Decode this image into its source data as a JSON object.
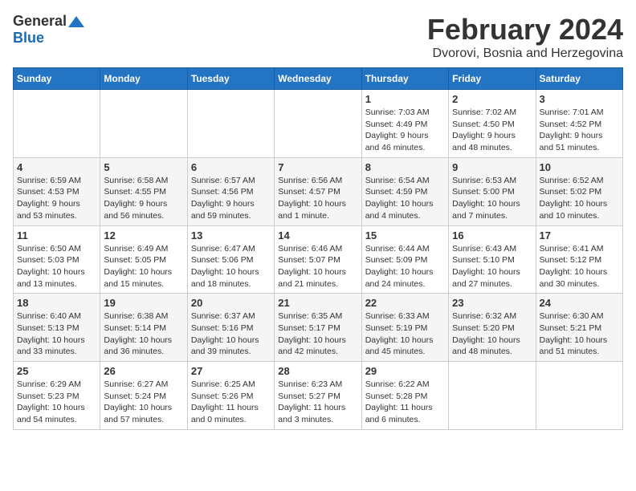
{
  "logo": {
    "general": "General",
    "blue": "Blue"
  },
  "header": {
    "month": "February 2024",
    "location": "Dvorovi, Bosnia and Herzegovina"
  },
  "weekdays": [
    "Sunday",
    "Monday",
    "Tuesday",
    "Wednesday",
    "Thursday",
    "Friday",
    "Saturday"
  ],
  "weeks": [
    [
      {
        "day": "",
        "info": ""
      },
      {
        "day": "",
        "info": ""
      },
      {
        "day": "",
        "info": ""
      },
      {
        "day": "",
        "info": ""
      },
      {
        "day": "1",
        "info": "Sunrise: 7:03 AM\nSunset: 4:49 PM\nDaylight: 9 hours\nand 46 minutes."
      },
      {
        "day": "2",
        "info": "Sunrise: 7:02 AM\nSunset: 4:50 PM\nDaylight: 9 hours\nand 48 minutes."
      },
      {
        "day": "3",
        "info": "Sunrise: 7:01 AM\nSunset: 4:52 PM\nDaylight: 9 hours\nand 51 minutes."
      }
    ],
    [
      {
        "day": "4",
        "info": "Sunrise: 6:59 AM\nSunset: 4:53 PM\nDaylight: 9 hours\nand 53 minutes."
      },
      {
        "day": "5",
        "info": "Sunrise: 6:58 AM\nSunset: 4:55 PM\nDaylight: 9 hours\nand 56 minutes."
      },
      {
        "day": "6",
        "info": "Sunrise: 6:57 AM\nSunset: 4:56 PM\nDaylight: 9 hours\nand 59 minutes."
      },
      {
        "day": "7",
        "info": "Sunrise: 6:56 AM\nSunset: 4:57 PM\nDaylight: 10 hours\nand 1 minute."
      },
      {
        "day": "8",
        "info": "Sunrise: 6:54 AM\nSunset: 4:59 PM\nDaylight: 10 hours\nand 4 minutes."
      },
      {
        "day": "9",
        "info": "Sunrise: 6:53 AM\nSunset: 5:00 PM\nDaylight: 10 hours\nand 7 minutes."
      },
      {
        "day": "10",
        "info": "Sunrise: 6:52 AM\nSunset: 5:02 PM\nDaylight: 10 hours\nand 10 minutes."
      }
    ],
    [
      {
        "day": "11",
        "info": "Sunrise: 6:50 AM\nSunset: 5:03 PM\nDaylight: 10 hours\nand 13 minutes."
      },
      {
        "day": "12",
        "info": "Sunrise: 6:49 AM\nSunset: 5:05 PM\nDaylight: 10 hours\nand 15 minutes."
      },
      {
        "day": "13",
        "info": "Sunrise: 6:47 AM\nSunset: 5:06 PM\nDaylight: 10 hours\nand 18 minutes."
      },
      {
        "day": "14",
        "info": "Sunrise: 6:46 AM\nSunset: 5:07 PM\nDaylight: 10 hours\nand 21 minutes."
      },
      {
        "day": "15",
        "info": "Sunrise: 6:44 AM\nSunset: 5:09 PM\nDaylight: 10 hours\nand 24 minutes."
      },
      {
        "day": "16",
        "info": "Sunrise: 6:43 AM\nSunset: 5:10 PM\nDaylight: 10 hours\nand 27 minutes."
      },
      {
        "day": "17",
        "info": "Sunrise: 6:41 AM\nSunset: 5:12 PM\nDaylight: 10 hours\nand 30 minutes."
      }
    ],
    [
      {
        "day": "18",
        "info": "Sunrise: 6:40 AM\nSunset: 5:13 PM\nDaylight: 10 hours\nand 33 minutes."
      },
      {
        "day": "19",
        "info": "Sunrise: 6:38 AM\nSunset: 5:14 PM\nDaylight: 10 hours\nand 36 minutes."
      },
      {
        "day": "20",
        "info": "Sunrise: 6:37 AM\nSunset: 5:16 PM\nDaylight: 10 hours\nand 39 minutes."
      },
      {
        "day": "21",
        "info": "Sunrise: 6:35 AM\nSunset: 5:17 PM\nDaylight: 10 hours\nand 42 minutes."
      },
      {
        "day": "22",
        "info": "Sunrise: 6:33 AM\nSunset: 5:19 PM\nDaylight: 10 hours\nand 45 minutes."
      },
      {
        "day": "23",
        "info": "Sunrise: 6:32 AM\nSunset: 5:20 PM\nDaylight: 10 hours\nand 48 minutes."
      },
      {
        "day": "24",
        "info": "Sunrise: 6:30 AM\nSunset: 5:21 PM\nDaylight: 10 hours\nand 51 minutes."
      }
    ],
    [
      {
        "day": "25",
        "info": "Sunrise: 6:29 AM\nSunset: 5:23 PM\nDaylight: 10 hours\nand 54 minutes."
      },
      {
        "day": "26",
        "info": "Sunrise: 6:27 AM\nSunset: 5:24 PM\nDaylight: 10 hours\nand 57 minutes."
      },
      {
        "day": "27",
        "info": "Sunrise: 6:25 AM\nSunset: 5:26 PM\nDaylight: 11 hours\nand 0 minutes."
      },
      {
        "day": "28",
        "info": "Sunrise: 6:23 AM\nSunset: 5:27 PM\nDaylight: 11 hours\nand 3 minutes."
      },
      {
        "day": "29",
        "info": "Sunrise: 6:22 AM\nSunset: 5:28 PM\nDaylight: 11 hours\nand 6 minutes."
      },
      {
        "day": "",
        "info": ""
      },
      {
        "day": "",
        "info": ""
      }
    ]
  ]
}
